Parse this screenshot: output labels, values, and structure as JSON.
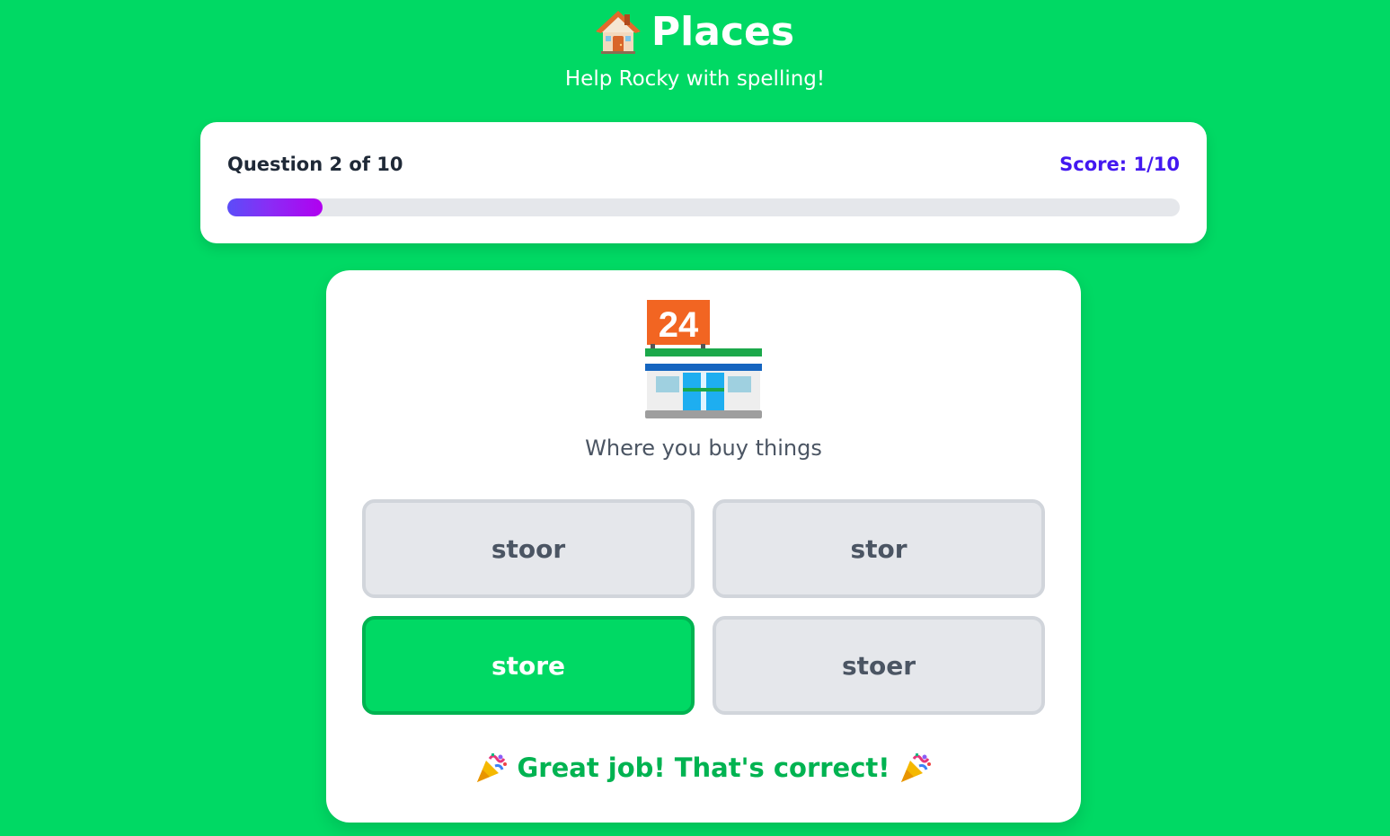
{
  "header": {
    "title": "Places",
    "title_icon": "house-icon",
    "subtitle": "Help Rocky with spelling!"
  },
  "progress": {
    "question_text": "Question 2 of 10",
    "score_text": "Score: 1/10",
    "current_question": 2,
    "total_questions": 10,
    "fill_fraction": 0.1
  },
  "question": {
    "icon": "convenience-store-icon",
    "icon_sign_text": "24",
    "clue": "Where you buy things"
  },
  "options": [
    {
      "label": "stoor",
      "state": "default"
    },
    {
      "label": "stor",
      "state": "default"
    },
    {
      "label": "store",
      "state": "correct"
    },
    {
      "label": "stoer",
      "state": "default"
    }
  ],
  "feedback": {
    "text": "Great job! That's correct!",
    "icon": "party-popper-icon"
  },
  "colors": {
    "background": "#00d964",
    "accent": "#4318f0",
    "correct": "#00d964",
    "correct_text": "#00b351"
  }
}
